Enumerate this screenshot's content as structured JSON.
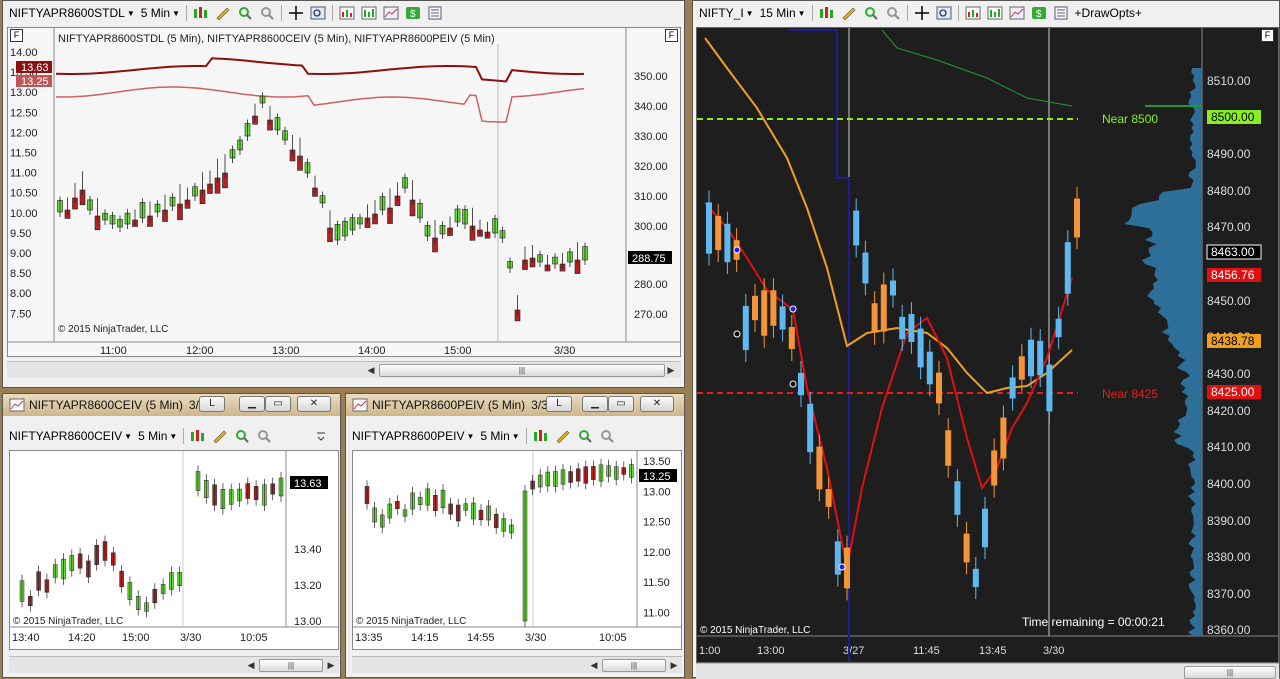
{
  "main_window": {
    "instrument": "NIFTYAPR8600STDL",
    "interval": "5 Min",
    "legend": "NIFTYAPR8600STDL (5 Min), NIFTYAPR8600CEIV (5 Min), NIFTYAPR8600PEIV (5 Min)",
    "copyright": "© 2015 NinjaTrader, LLC",
    "left_axis": [
      "14.00",
      "13.50",
      "13.00",
      "12.50",
      "12.00",
      "11.50",
      "11.00",
      "10.50",
      "10.00",
      "9.50",
      "9.00",
      "8.50",
      "8.00",
      "7.50"
    ],
    "right_axis": [
      "350.00",
      "340.00",
      "330.00",
      "320.00",
      "310.00",
      "300.00",
      "280.00",
      "270.00"
    ],
    "x_axis": [
      "11:00",
      "12:00",
      "13:00",
      "14:00",
      "15:00",
      "3/30"
    ],
    "tag_ce": "13.63",
    "tag_pe": "13.25",
    "tag_price": "288.75",
    "f_label": "F"
  },
  "ce_window": {
    "title": "NIFTYAPR8600CEIV (5 Min)",
    "title_extra": "3/",
    "instrument": "NIFTYAPR8600CEIV",
    "interval": "5 Min",
    "axis": [
      "13.40",
      "13.20",
      "13.00"
    ],
    "tag": "13.63",
    "x_axis": [
      "13:40",
      "14:20",
      "15:00",
      "3/30",
      "10:05"
    ],
    "copyright": "© 2015 NinjaTrader, LLC",
    "btn_l": "L"
  },
  "pe_window": {
    "title": "NIFTYAPR8600PEIV (5 Min)",
    "title_extra": "3/3",
    "instrument": "NIFTYAPR8600PEIV",
    "interval": "5 Min",
    "axis": [
      "13.50",
      "13.00",
      "12.50",
      "12.00",
      "11.50",
      "11.00"
    ],
    "tag": "13.25",
    "x_axis": [
      "13:35",
      "14:15",
      "14:55",
      "3/30",
      "10:05"
    ],
    "copyright": "© 2015 NinjaTrader, LLC",
    "btn_l": "L"
  },
  "nifty_window": {
    "instrument": "NIFTY_I",
    "interval": "15 Min",
    "draw_opts": "+DrawOpts+",
    "axis": [
      "8510.00",
      "8490.00",
      "8480.00",
      "8470.00",
      "8450.00",
      "8440.00",
      "8430.00",
      "8420.00",
      "8410.00",
      "8400.00",
      "8390.00",
      "8380.00",
      "8370.00",
      "8360.00"
    ],
    "tag_8500": "8500.00",
    "tag_8463": "8463.00",
    "tag_8456": "8456.76",
    "tag_8438": "8438.78",
    "tag_8425": "8425.00",
    "near_upper": "Near 8500",
    "near_lower": "Near 8425",
    "time_remaining": "Time remaining = 00:00:21",
    "copyright": "© 2015 NinjaTrader, LLC",
    "x_axis": [
      "1:00",
      "13:00",
      "3/27",
      "11:45",
      "13:45",
      "3/30"
    ],
    "f_label": "F"
  },
  "colors": {
    "up": "#66dd33",
    "down": "#b22222",
    "nifty_up": "#5fb8f0",
    "nifty_down": "#f5953a",
    "near_upper": "#88ee22",
    "near_lower": "#e02020"
  }
}
